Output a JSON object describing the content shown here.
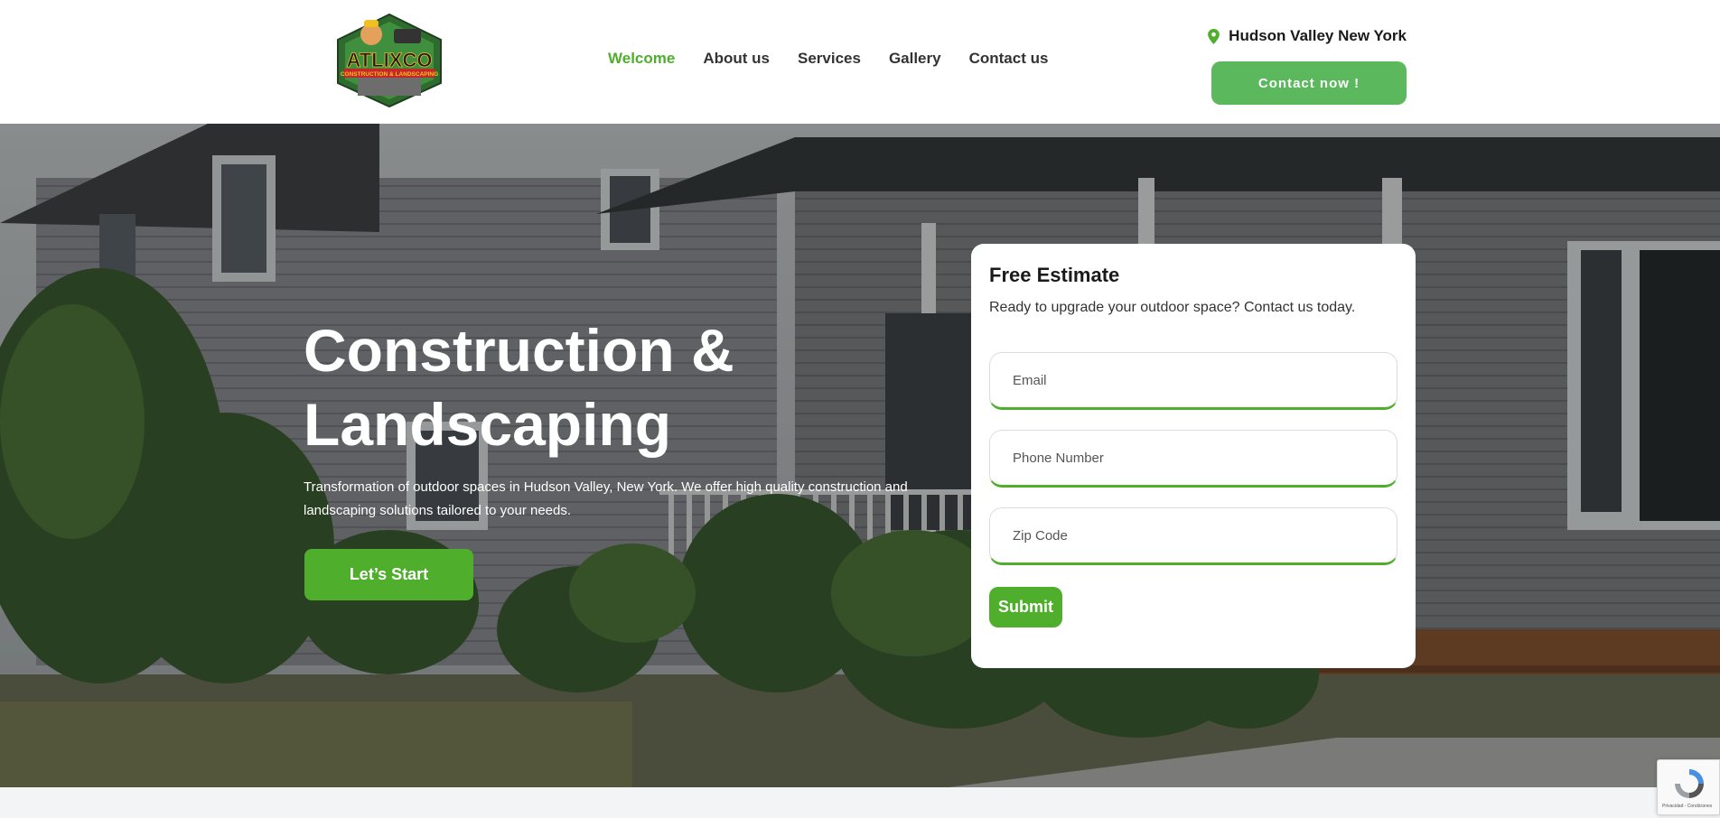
{
  "brand": {
    "logo_text": "ATLIXCO",
    "logo_subtext": "CONSTRUCTION & LANDSCAPING"
  },
  "nav": {
    "items": [
      {
        "label": "Welcome",
        "active": true
      },
      {
        "label": "About us"
      },
      {
        "label": "Services"
      },
      {
        "label": "Gallery"
      },
      {
        "label": "Contact us"
      }
    ]
  },
  "header": {
    "location": "Hudson Valley New York",
    "contact_button": "Contact now !"
  },
  "hero": {
    "title_line1": "Construction &",
    "title_line2": "Landscaping",
    "description": "Transformation of outdoor spaces in Hudson Valley, New York. We offer high quality construction and landscaping solutions tailored to your needs.",
    "cta": "Let’s Start"
  },
  "estimate_form": {
    "title": "Free Estimate",
    "subtitle": "Ready to upgrade your outdoor space? Contact us today.",
    "email_placeholder": "Email",
    "phone_placeholder": "Phone Number",
    "zip_placeholder": "Zip Code",
    "submit": "Submit"
  },
  "recaptcha": {
    "text": "Privacidad - Condiciones"
  },
  "colors": {
    "accent": "#4fae2c",
    "contact_button": "#5cb85c"
  }
}
